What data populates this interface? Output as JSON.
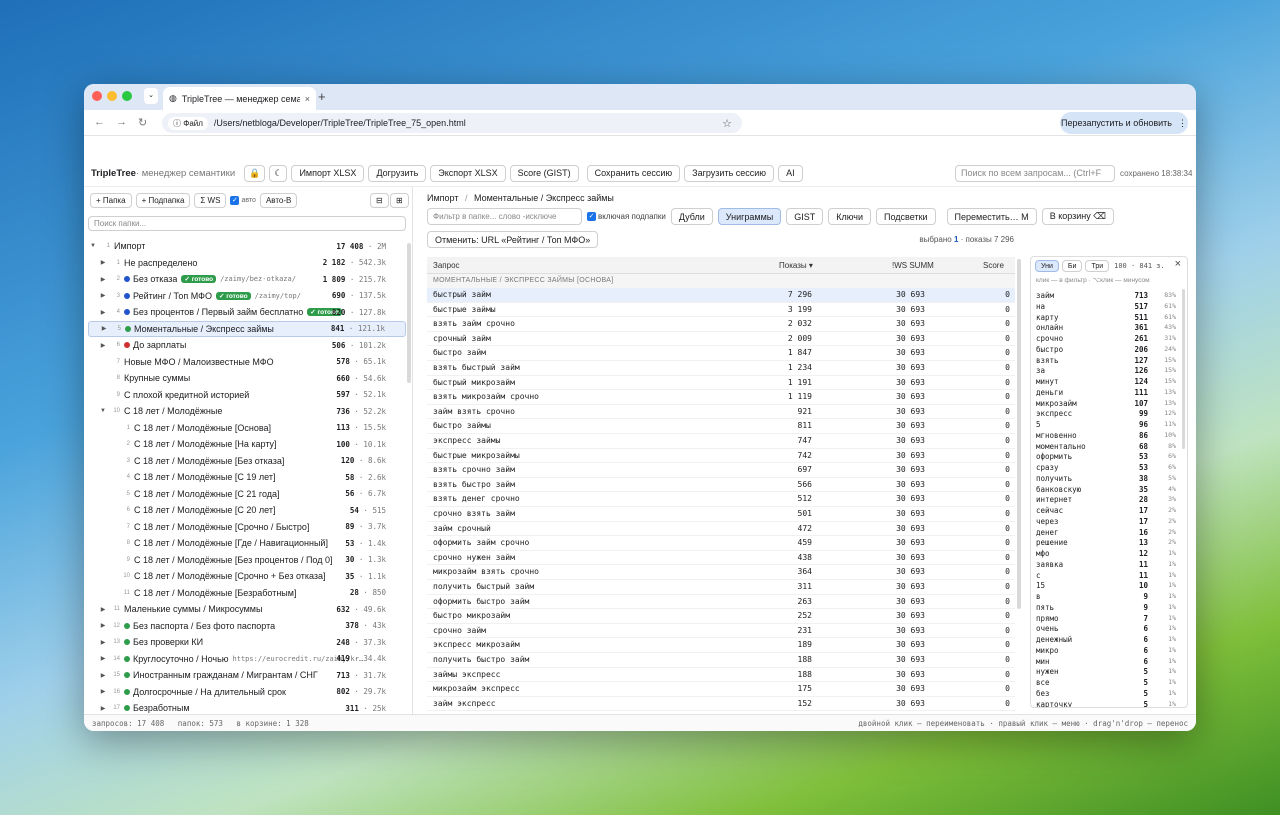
{
  "browser": {
    "tab_title": "TripleTree — менеджер семантики",
    "file_chip": "Файл",
    "url": "/Users/netbloga/Developer/TripleTree/TripleTree_75_open.html",
    "relaunch": "Перезапустить и обновить"
  },
  "app": {
    "title": "TripleTree",
    "subtitle": "· менеджер семантики",
    "buttons": [
      "Импорт XLSX",
      "Догрузить",
      "Экспорт XLSX",
      "Score (GIST)",
      "Сохранить сессию",
      "Загрузить сессию",
      "AI"
    ],
    "search_placeholder": "Поиск по всем запросам... (Ctrl+F",
    "saved": "сохранено 18:38:34"
  },
  "sidebar": {
    "btn_folder": "+ Папка",
    "btn_subfolder": "+ Подпапка",
    "btn_ws": "Σ WS",
    "auto_label": "авто",
    "btn_autob": "Авто-В",
    "search_placeholder": "Поиск папки...",
    "rows": [
      {
        "arrow": "▼",
        "num": "1",
        "color": "",
        "label": "Импорт",
        "badge": "",
        "url": "",
        "count": "17 408",
        "sum": "2M",
        "indent": 0
      },
      {
        "arrow": "▶",
        "num": "1",
        "color": "",
        "label": "Не распределено",
        "badge": "",
        "url": "",
        "count": "2 182",
        "sum": "542.3k",
        "indent": 1
      },
      {
        "arrow": "▶",
        "num": "2",
        "color": "#2255cc",
        "label": "Без отказа",
        "badge": "✓ готово",
        "url": "/zaimy/bez-otkaza/",
        "count": "1 809",
        "sum": "215.7k",
        "indent": 1
      },
      {
        "arrow": "▶",
        "num": "3",
        "color": "#2255cc",
        "label": "Рейтинг / Топ МФО",
        "badge": "✓ готово",
        "url": "/zaimy/top/",
        "count": "690",
        "sum": "137.5k",
        "indent": 1
      },
      {
        "arrow": "▶",
        "num": "4",
        "color": "#2255cc",
        "label": "Без процентов / Первый займ бесплатно",
        "badge": "✓ готово",
        "url": "",
        "count": "820",
        "sum": "127.8k",
        "indent": 1
      },
      {
        "arrow": "▶",
        "num": "5",
        "color": "#2e9c4a",
        "label": "Моментальные / Экспресс займы",
        "badge": "",
        "url": "",
        "count": "841",
        "sum": "121.1k",
        "indent": 1,
        "selected": true
      },
      {
        "arrow": "▶",
        "num": "6",
        "color": "#d03030",
        "label": "До зарплаты",
        "badge": "",
        "url": "",
        "count": "506",
        "sum": "101.2k",
        "indent": 1
      },
      {
        "arrow": "",
        "num": "7",
        "color": "",
        "label": "Новые МФО / Малоизвестные МФО",
        "badge": "",
        "url": "",
        "count": "578",
        "sum": "65.1k",
        "indent": 1
      },
      {
        "arrow": "",
        "num": "8",
        "color": "",
        "label": "Крупные суммы",
        "badge": "",
        "url": "",
        "count": "660",
        "sum": "54.6k",
        "indent": 1
      },
      {
        "arrow": "",
        "num": "9",
        "color": "",
        "label": "С плохой кредитной историей",
        "badge": "",
        "url": "",
        "count": "597",
        "sum": "52.1k",
        "indent": 1
      },
      {
        "arrow": "▼",
        "num": "10",
        "color": "",
        "label": "С 18 лет / Молодёжные",
        "badge": "",
        "url": "",
        "count": "736",
        "sum": "52.2k",
        "indent": 1
      },
      {
        "arrow": "",
        "num": "1",
        "color": "",
        "label": "С 18 лет / Молодёжные [Основа]",
        "badge": "",
        "url": "",
        "count": "113",
        "sum": "15.5k",
        "indent": 2
      },
      {
        "arrow": "",
        "num": "2",
        "color": "",
        "label": "С 18 лет / Молодёжные [На карту]",
        "badge": "",
        "url": "",
        "count": "100",
        "sum": "10.1k",
        "indent": 2
      },
      {
        "arrow": "",
        "num": "3",
        "color": "",
        "label": "С 18 лет / Молодёжные [Без отказа]",
        "badge": "",
        "url": "",
        "count": "120",
        "sum": "8.6k",
        "indent": 2
      },
      {
        "arrow": "",
        "num": "4",
        "color": "",
        "label": "С 18 лет / Молодёжные [С 19 лет]",
        "badge": "",
        "url": "",
        "count": "58",
        "sum": "2.6k",
        "indent": 2
      },
      {
        "arrow": "",
        "num": "5",
        "color": "",
        "label": "С 18 лет / Молодёжные [С 21 года]",
        "badge": "",
        "url": "",
        "count": "56",
        "sum": "6.7k",
        "indent": 2
      },
      {
        "arrow": "",
        "num": "6",
        "color": "",
        "label": "С 18 лет / Молодёжные [С 20 лет]",
        "badge": "",
        "url": "",
        "count": "54",
        "sum": "515",
        "indent": 2
      },
      {
        "arrow": "",
        "num": "7",
        "color": "",
        "label": "С 18 лет / Молодёжные [Срочно / Быстро]",
        "badge": "",
        "url": "",
        "count": "89",
        "sum": "3.7k",
        "indent": 2
      },
      {
        "arrow": "",
        "num": "8",
        "color": "",
        "label": "С 18 лет / Молодёжные [Где / Навигационный]",
        "badge": "",
        "url": "",
        "count": "53",
        "sum": "1.4k",
        "indent": 2
      },
      {
        "arrow": "",
        "num": "9",
        "color": "",
        "label": "С 18 лет / Молодёжные [Без процентов / Под 0]",
        "badge": "",
        "url": "",
        "count": "30",
        "sum": "1.3k",
        "indent": 2
      },
      {
        "arrow": "",
        "num": "10",
        "color": "",
        "label": "С 18 лет / Молодёжные [Срочно + Без отказа]",
        "badge": "",
        "url": "",
        "count": "35",
        "sum": "1.1k",
        "indent": 2
      },
      {
        "arrow": "",
        "num": "11",
        "color": "",
        "label": "С 18 лет / Молодёжные [Безработным]",
        "badge": "",
        "url": "",
        "count": "28",
        "sum": "850",
        "indent": 2
      },
      {
        "arrow": "▶",
        "num": "11",
        "color": "",
        "label": "Маленькие суммы / Микросуммы",
        "badge": "",
        "url": "",
        "count": "632",
        "sum": "49.6k",
        "indent": 1
      },
      {
        "arrow": "▶",
        "num": "12",
        "color": "#2e9c4a",
        "label": "Без паспорта / Без фото паспорта",
        "badge": "",
        "url": "",
        "count": "378",
        "sum": "43k",
        "indent": 1
      },
      {
        "arrow": "▶",
        "num": "13",
        "color": "#2e9c4a",
        "label": "Без проверки КИ",
        "badge": "",
        "url": "",
        "count": "248",
        "sum": "37.3k",
        "indent": 1
      },
      {
        "arrow": "▶",
        "num": "14",
        "color": "#2e9c4a",
        "label": "Круглосуточно / Ночью",
        "badge": "",
        "url": "https://eurocredit.ru/zaimy/kr…",
        "count": "419",
        "sum": "34.4k",
        "indent": 1
      },
      {
        "arrow": "▶",
        "num": "15",
        "color": "#2e9c4a",
        "label": "Иностранным гражданам / Мигрантам / СНГ",
        "badge": "",
        "url": "",
        "count": "713",
        "sum": "31.7k",
        "indent": 1
      },
      {
        "arrow": "▶",
        "num": "16",
        "color": "#2e9c4a",
        "label": "Долгосрочные / На длительный срок",
        "badge": "",
        "url": "",
        "count": "802",
        "sum": "29.7k",
        "indent": 1
      },
      {
        "arrow": "▶",
        "num": "17",
        "color": "#2e9c4a",
        "label": "Безработным",
        "badge": "",
        "url": "",
        "count": "311",
        "sum": "25k",
        "indent": 1
      }
    ]
  },
  "center": {
    "breadcrumb_root": "Импорт",
    "breadcrumb_sep": "/",
    "breadcrumb_current": "Моментальные / Экспресс займы",
    "filter_placeholder": "Фильтр в папке... слово -исключе",
    "include_sub": "включая подпапки",
    "buttons": [
      "Дубли",
      "Униграммы",
      "GIST",
      "Ключи",
      "Подсветки",
      "Переместить… M",
      "В корзину ⌫"
    ],
    "undo": "Отменить: URL «Рейтинг / Топ МФО»",
    "selected_label": "выбрано",
    "selected_count": "1",
    "shows_label": "· показы 7 296",
    "columns": {
      "query": "Запрос",
      "shows": "Показы ▾",
      "ws": "!WS SUMM",
      "score": "Score"
    },
    "group_header": "МОМЕНТАЛЬНЫЕ / ЭКСПРЕСС ЗАЙМЫ [ОСНОВА]",
    "rows": [
      [
        "быстрый займ",
        "7 296",
        "30 693",
        "0"
      ],
      [
        "быстрые займы",
        "3 199",
        "30 693",
        "0"
      ],
      [
        "взять займ срочно",
        "2 032",
        "30 693",
        "0"
      ],
      [
        "срочный займ",
        "2 009",
        "30 693",
        "0"
      ],
      [
        "быстро займ",
        "1 847",
        "30 693",
        "0"
      ],
      [
        "взять быстрый займ",
        "1 234",
        "30 693",
        "0"
      ],
      [
        "быстрый микрозайм",
        "1 191",
        "30 693",
        "0"
      ],
      [
        "взять микрозайм срочно",
        "1 119",
        "30 693",
        "0"
      ],
      [
        "займ взять срочно",
        "921",
        "30 693",
        "0"
      ],
      [
        "быстро займы",
        "811",
        "30 693",
        "0"
      ],
      [
        "экспресс займы",
        "747",
        "30 693",
        "0"
      ],
      [
        "быстрые микрозаймы",
        "742",
        "30 693",
        "0"
      ],
      [
        "взять срочно займ",
        "697",
        "30 693",
        "0"
      ],
      [
        "взять быстро займ",
        "566",
        "30 693",
        "0"
      ],
      [
        "взять денег срочно",
        "512",
        "30 693",
        "0"
      ],
      [
        "срочно взять займ",
        "501",
        "30 693",
        "0"
      ],
      [
        "займ срочный",
        "472",
        "30 693",
        "0"
      ],
      [
        "оформить займ срочно",
        "459",
        "30 693",
        "0"
      ],
      [
        "срочно нужен займ",
        "438",
        "30 693",
        "0"
      ],
      [
        "микрозайм взять срочно",
        "364",
        "30 693",
        "0"
      ],
      [
        "получить быстрый займ",
        "311",
        "30 693",
        "0"
      ],
      [
        "оформить быстро займ",
        "263",
        "30 693",
        "0"
      ],
      [
        "быстро микрозайм",
        "252",
        "30 693",
        "0"
      ],
      [
        "срочно займ",
        "231",
        "30 693",
        "0"
      ],
      [
        "экспресс микрозайм",
        "189",
        "30 693",
        "0"
      ],
      [
        "получить быстро займ",
        "188",
        "30 693",
        "0"
      ],
      [
        "займы экспресс",
        "188",
        "30 693",
        "0"
      ],
      [
        "микрозайм экспресс",
        "175",
        "30 693",
        "0"
      ],
      [
        "займ экспресс",
        "152",
        "30 693",
        "0"
      ]
    ]
  },
  "unigrams": {
    "tabs": [
      "Уни",
      "Би",
      "Три"
    ],
    "meta": "100 · 841 з.",
    "close": "×",
    "hint": "клик — в фильтр · ⌥клик — минусом",
    "rows": [
      [
        "займ",
        "713",
        "83%"
      ],
      [
        "на",
        "517",
        "61%"
      ],
      [
        "карту",
        "511",
        "61%"
      ],
      [
        "онлайн",
        "361",
        "43%"
      ],
      [
        "срочно",
        "261",
        "31%"
      ],
      [
        "быстро",
        "206",
        "24%"
      ],
      [
        "взять",
        "127",
        "15%"
      ],
      [
        "за",
        "126",
        "15%"
      ],
      [
        "минут",
        "124",
        "15%"
      ],
      [
        "деньги",
        "111",
        "13%"
      ],
      [
        "микрозайм",
        "107",
        "13%"
      ],
      [
        "экспресс",
        "99",
        "12%"
      ],
      [
        "5",
        "96",
        "11%"
      ],
      [
        "мгновенно",
        "86",
        "10%"
      ],
      [
        "моментально",
        "68",
        "8%"
      ],
      [
        "оформить",
        "53",
        "6%"
      ],
      [
        "сразу",
        "53",
        "6%"
      ],
      [
        "получить",
        "38",
        "5%"
      ],
      [
        "банковскую",
        "35",
        "4%"
      ],
      [
        "интернет",
        "28",
        "3%"
      ],
      [
        "сейчас",
        "17",
        "2%"
      ],
      [
        "через",
        "17",
        "2%"
      ],
      [
        "денег",
        "16",
        "2%"
      ],
      [
        "решение",
        "13",
        "2%"
      ],
      [
        "мфо",
        "12",
        "1%"
      ],
      [
        "заявка",
        "11",
        "1%"
      ],
      [
        "с",
        "11",
        "1%"
      ],
      [
        "15",
        "10",
        "1%"
      ],
      [
        "в",
        "9",
        "1%"
      ],
      [
        "пять",
        "9",
        "1%"
      ],
      [
        "прямо",
        "7",
        "1%"
      ],
      [
        "очень",
        "6",
        "1%"
      ],
      [
        "денежный",
        "6",
        "1%"
      ],
      [
        "микро",
        "6",
        "1%"
      ],
      [
        "мин",
        "6",
        "1%"
      ],
      [
        "нужен",
        "5",
        "1%"
      ],
      [
        "все",
        "5",
        "1%"
      ],
      [
        "без",
        "5",
        "1%"
      ],
      [
        "карточку",
        "5",
        "1%"
      ]
    ]
  },
  "status": {
    "left": "запросов: 17 408   папок: 573   в корзине: 1 328",
    "right": "двойной клик — переименовать · правый клик — меню · drag'n'drop — перенос"
  },
  "colors": {
    "accent": "#2e9c4a",
    "blue": "#2255cc",
    "red": "#d03030",
    "selection": "#e6effb"
  }
}
